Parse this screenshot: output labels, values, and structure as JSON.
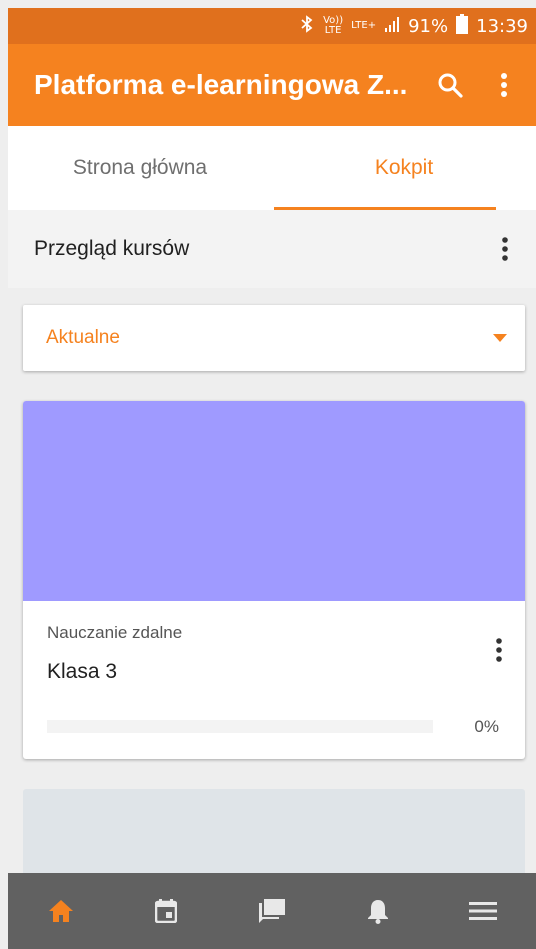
{
  "status_bar": {
    "volte_top": "Vo))",
    "volte_bottom": "LTE",
    "lte": "LTE+",
    "battery_percent": "91%",
    "time": "13:39",
    "icons": [
      "bluetooth-icon",
      "signal-icon",
      "battery-icon"
    ]
  },
  "app_bar": {
    "title": "Platforma e-learningowa Z...",
    "icons": [
      "search-icon",
      "more-vert-icon"
    ]
  },
  "tabs": [
    {
      "label": "Strona główna",
      "active": false
    },
    {
      "label": "Kokpit",
      "active": true
    }
  ],
  "section": {
    "title": "Przegląd kursów"
  },
  "filter": {
    "selected": "Aktualne"
  },
  "courses": [
    {
      "category": "Nauczanie zdalne",
      "name": "Klasa 3",
      "progress": 0,
      "progress_label": "0%",
      "image_color": "#9f9aff"
    }
  ],
  "bottom_nav": [
    {
      "icon": "home-icon",
      "active": true
    },
    {
      "icon": "calendar-icon",
      "active": false
    },
    {
      "icon": "messages-icon",
      "active": false
    },
    {
      "icon": "notifications-icon",
      "active": false
    },
    {
      "icon": "menu-icon",
      "active": false
    }
  ],
  "colors": {
    "accent": "#f5821f",
    "status_bar": "#e0701d",
    "nav_bg": "#616161"
  }
}
